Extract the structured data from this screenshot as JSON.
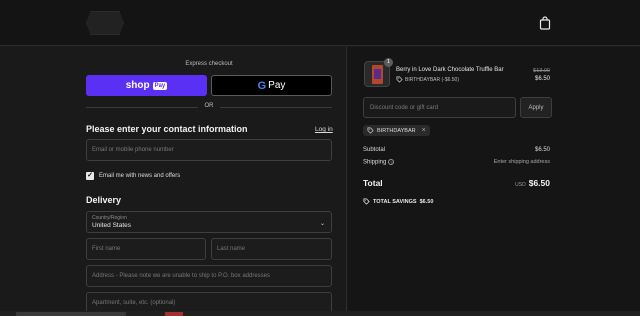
{
  "header": {
    "logo": "store-logo",
    "cart_icon": "shopping-bag-icon"
  },
  "express": {
    "label": "Express checkout",
    "shop_pay_brand": "shop",
    "shop_pay_badge": "Pay",
    "gpay_g": "G",
    "gpay_label": "Pay",
    "or_label": "OR"
  },
  "contact": {
    "heading": "Please enter your contact information",
    "login_link": "Log in",
    "email_placeholder": "Email or mobile phone number",
    "newsletter_checked": true,
    "newsletter_label": "Email me with news and offers"
  },
  "delivery": {
    "heading": "Delivery",
    "country_label": "Country/Region",
    "country_value": "United States",
    "first_name_placeholder": "First name",
    "last_name_placeholder": "Last name",
    "address_placeholder": "Address - Please note we are unable to ship to P.O. box addresses",
    "apartment_placeholder": "Apartment, suite, etc. (optional)"
  },
  "summary": {
    "product": {
      "quantity": "1",
      "name": "Berry in Love Dark Chocolate Truffle Bar",
      "discount_line": "BIRTHDAYBAR (-$6.50)",
      "original_price": "$13.00",
      "price": "$6.50"
    },
    "discount_placeholder": "Discount code or gift card",
    "apply_label": "Apply",
    "applied_code": "BIRTHDAYBAR",
    "subtotal_label": "Subtotal",
    "subtotal_value": "$6.50",
    "shipping_label": "Shipping",
    "shipping_value": "Enter shipping address",
    "total_label": "Total",
    "total_currency": "USD",
    "total_value": "$6.50",
    "savings_label": "TOTAL SAVINGS",
    "savings_value": "$6.50"
  },
  "colors": {
    "shop_pay": "#5a31f4",
    "background": "#1a1a1a",
    "summary_background": "#151515"
  }
}
